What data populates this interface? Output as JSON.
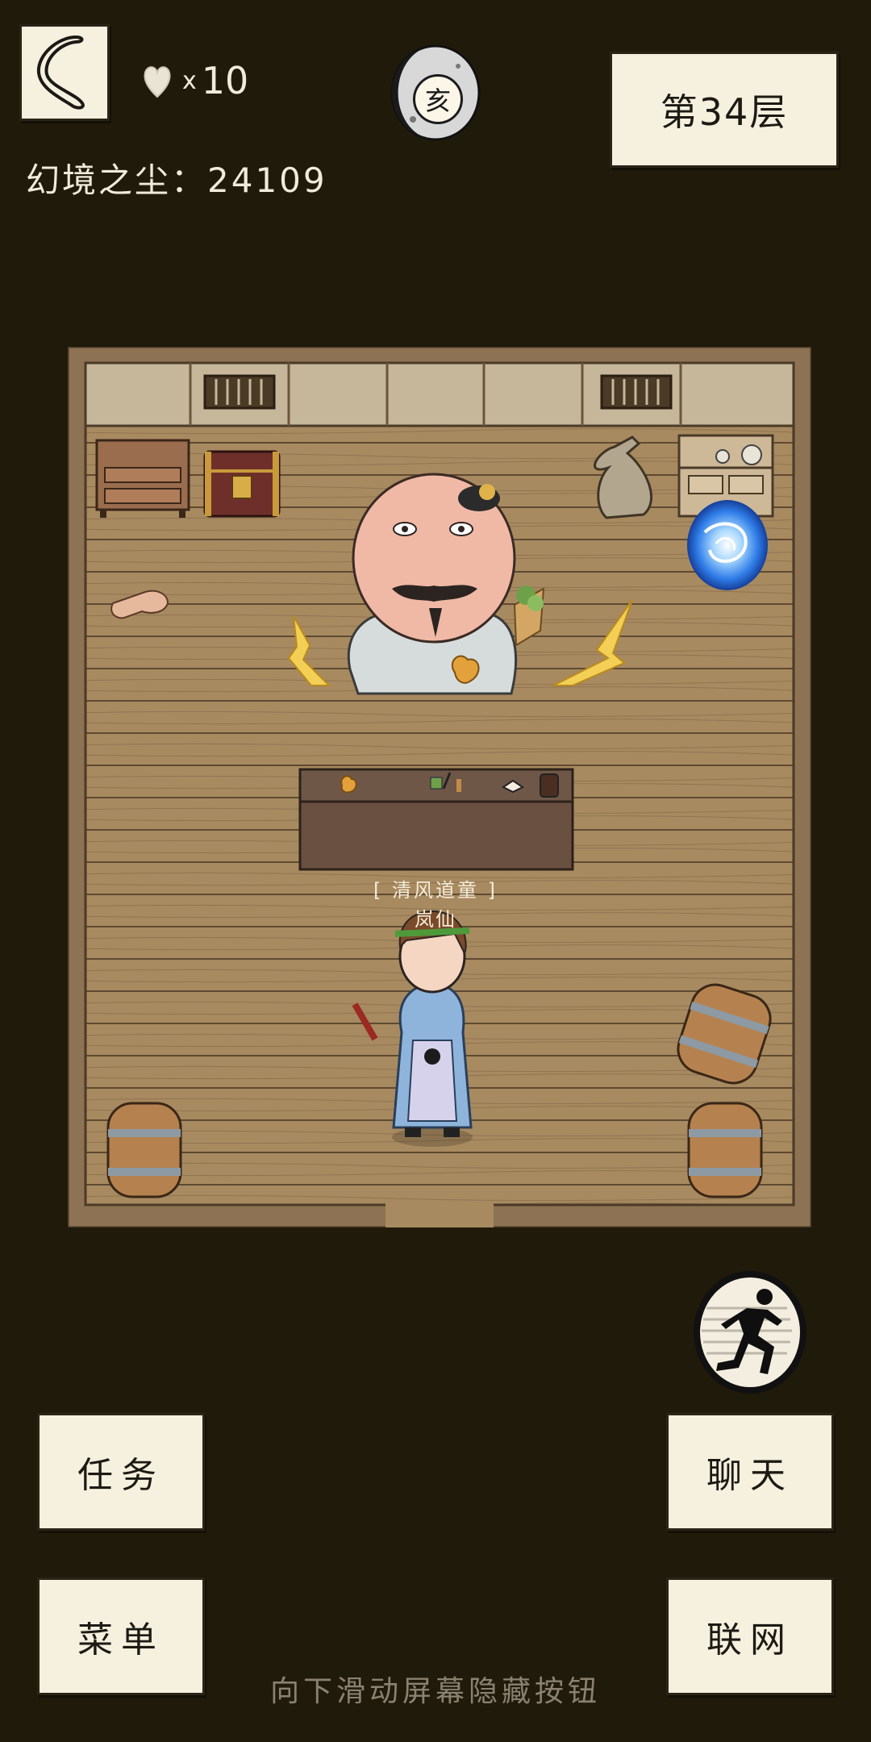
{
  "hud": {
    "lives_count": "10",
    "lives_x": "x",
    "dust_label": "幻境之尘：24109",
    "time_char": "亥",
    "floor_label": "第34层",
    "icons": {
      "back": "back-arrow-icon",
      "lives": "heart-icon",
      "time": "moon-icon",
      "run": "run-icon"
    }
  },
  "scene": {
    "npc_title": "[ 清风道童 ]",
    "npc_name": "岚仙"
  },
  "buttons": {
    "quest": "任务",
    "chat": "聊天",
    "menu": "菜单",
    "network": "联网"
  },
  "footer": {
    "hint": "向下滑动屏幕隐藏按钮"
  },
  "colors": {
    "background": "#201a0b",
    "paper": "#f6f0de",
    "floor": "#a88a60",
    "wall": "#c5b69a"
  }
}
